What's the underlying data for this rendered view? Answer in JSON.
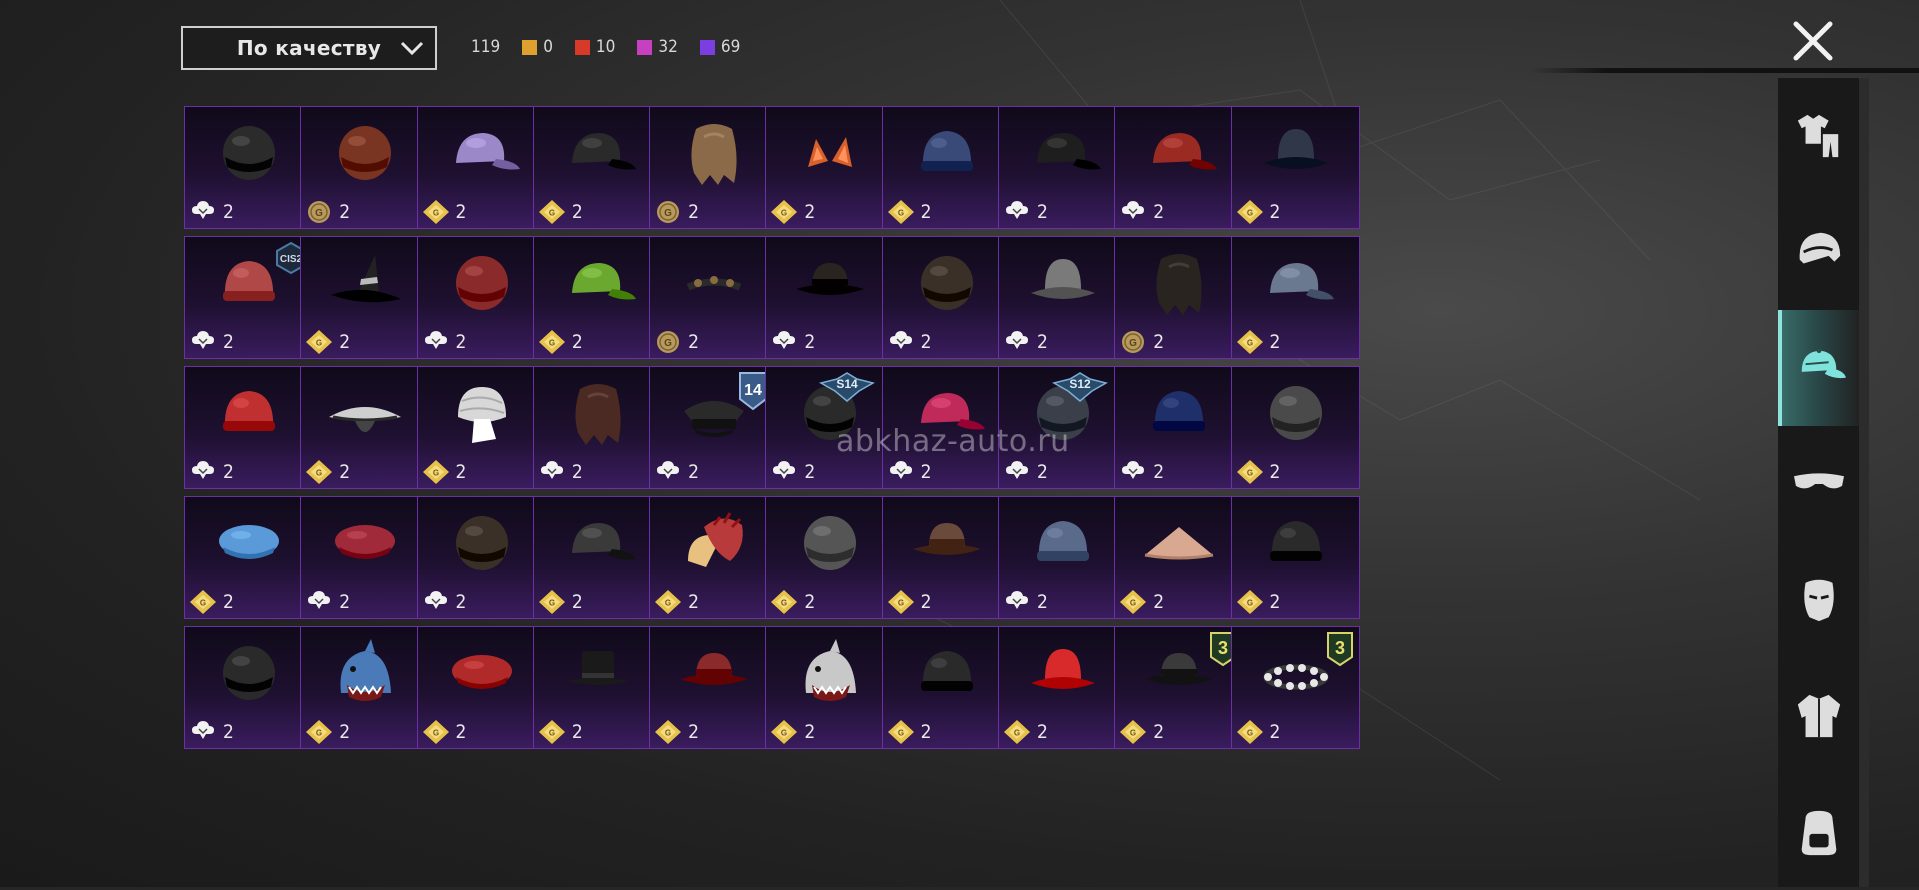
{
  "sort": {
    "label": "По качеству"
  },
  "counts": [
    {
      "value": "119",
      "color": null
    },
    {
      "value": "0",
      "color": "#e0a030"
    },
    {
      "value": "10",
      "color": "#d83a2a"
    },
    {
      "value": "32",
      "color": "#c640c0"
    },
    {
      "value": "69",
      "color": "#7b3ee0"
    }
  ],
  "watermark": "abkhaz-auto.ru",
  "icons": {
    "close": "close-icon",
    "dropdown": "chevron-down-icon"
  },
  "colors": {
    "cell_border": "#6c2fa8",
    "active_tab": "#8fe3dd",
    "cell_bg": "#1e1030"
  },
  "tabs": [
    {
      "name": "outfit-icon",
      "active": false
    },
    {
      "name": "helmet-icon",
      "active": false
    },
    {
      "name": "cap-icon",
      "active": true
    },
    {
      "name": "glasses-icon",
      "active": false
    },
    {
      "name": "mask-icon",
      "active": false
    },
    {
      "name": "jacket-icon",
      "active": false
    },
    {
      "name": "backpack-icon",
      "active": false
    }
  ],
  "items": [
    {
      "name": "black-motorcycle-helmet",
      "icon": "bp",
      "count": "2",
      "color": "#2b2b2b",
      "shape": "helmet"
    },
    {
      "name": "aviator-hat-goggles",
      "icon": "coin",
      "count": "2",
      "color": "#7a3422",
      "shape": "helmet"
    },
    {
      "name": "colorful-cap",
      "icon": "gem",
      "count": "2",
      "color": "#9a88c8",
      "shape": "cap"
    },
    {
      "name": "black-cap",
      "icon": "gem",
      "count": "2",
      "color": "#2a2a2a",
      "shape": "cap"
    },
    {
      "name": "blonde-hair",
      "icon": "coin",
      "count": "2",
      "color": "#8a6a48",
      "shape": "hair"
    },
    {
      "name": "cat-ears",
      "icon": "gem",
      "count": "2",
      "color": "#d8602a",
      "shape": "ears"
    },
    {
      "name": "blue-beanie",
      "icon": "gem",
      "count": "2",
      "color": "#3a4a78",
      "shape": "beanie"
    },
    {
      "name": "black-mesh-cap",
      "icon": "bp",
      "count": "2",
      "color": "#1e1e1e",
      "shape": "cap"
    },
    {
      "name": "red-gold-cap",
      "icon": "bp",
      "count": "2",
      "color": "#9a2a22",
      "shape": "cap"
    },
    {
      "name": "bucket-hat-red-hair",
      "icon": "gem",
      "count": "2",
      "color": "#2f3748",
      "shape": "bucket"
    },
    {
      "name": "striped-bandana",
      "icon": "bp",
      "count": "2",
      "color": "#b04848",
      "shape": "beanie",
      "badge": "CIS2"
    },
    {
      "name": "witch-hat",
      "icon": "gem",
      "count": "2",
      "color": "#222222",
      "shape": "witch"
    },
    {
      "name": "red-racing-helmet",
      "icon": "bp",
      "count": "2",
      "color": "#8a2a2a",
      "shape": "helmet"
    },
    {
      "name": "green-cap",
      "icon": "gem",
      "count": "2",
      "color": "#6aa830",
      "shape": "cap"
    },
    {
      "name": "spiked-headband",
      "icon": "coin",
      "count": "2",
      "color": "#2a2a2a",
      "shape": "band"
    },
    {
      "name": "steampunk-hat",
      "icon": "bp",
      "count": "2",
      "color": "#2a2420",
      "shape": "fedora"
    },
    {
      "name": "samurai-helmet",
      "icon": "bp",
      "count": "2",
      "color": "#3a3028",
      "shape": "helmet"
    },
    {
      "name": "grey-fisherman-hat",
      "icon": "bp",
      "count": "2",
      "color": "#7a7a7a",
      "shape": "bucket"
    },
    {
      "name": "dark-hair",
      "icon": "coin",
      "count": "2",
      "color": "#2a2420",
      "shape": "hair"
    },
    {
      "name": "blue-grey-cap",
      "icon": "gem",
      "count": "2",
      "color": "#6a7890",
      "shape": "cap"
    },
    {
      "name": "red-white-helmet",
      "icon": "bp",
      "count": "2",
      "color": "#c03030",
      "shape": "beanie"
    },
    {
      "name": "straw-rice-hat",
      "icon": "gem",
      "count": "2",
      "color": "#2a2a2a",
      "shape": "rice"
    },
    {
      "name": "white-turban",
      "icon": "gem",
      "count": "2",
      "color": "#d8d8d8",
      "shape": "turban"
    },
    {
      "name": "demon-mask-hair",
      "icon": "bp",
      "count": "2",
      "color": "#4a2a22",
      "shape": "hair"
    },
    {
      "name": "police-cap",
      "icon": "bp",
      "count": "2",
      "color": "#2a2a2a",
      "shape": "police",
      "badge": "14"
    },
    {
      "name": "dark-balaclava",
      "icon": "bp",
      "count": "2",
      "color": "#2a2a2a",
      "shape": "helmet",
      "badge": "S14"
    },
    {
      "name": "pink-black-cap",
      "icon": "bp",
      "count": "2",
      "color": "#c02a5a",
      "shape": "cap"
    },
    {
      "name": "space-helmet",
      "icon": "bp",
      "count": "2",
      "color": "#3a3f4a",
      "shape": "helmet",
      "badge": "S12"
    },
    {
      "name": "navy-beanie",
      "icon": "bp",
      "count": "2",
      "color": "#1e2f6a",
      "shape": "beanie"
    },
    {
      "name": "camo-helmet-goggles",
      "icon": "gem",
      "count": "2",
      "color": "#4a4a4a",
      "shape": "helmet"
    },
    {
      "name": "blue-pom-hat",
      "icon": "gem",
      "count": "2",
      "color": "#5a9ad8",
      "shape": "beret"
    },
    {
      "name": "red-beret",
      "icon": "bp",
      "count": "2",
      "color": "#a02a3a",
      "shape": "beret"
    },
    {
      "name": "leather-pilot-cap",
      "icon": "bp",
      "count": "2",
      "color": "#3a3028",
      "shape": "helmet"
    },
    {
      "name": "dark-grey-cap",
      "icon": "gem",
      "count": "2",
      "color": "#3a3a3a",
      "shape": "cap"
    },
    {
      "name": "fried-chicken-hat",
      "icon": "gem",
      "count": "2",
      "color": "#b83a3a",
      "shape": "chicken"
    },
    {
      "name": "pith-helmet",
      "icon": "gem",
      "count": "2",
      "color": "#555555",
      "shape": "helmet"
    },
    {
      "name": "cowboy-hat",
      "icon": "gem",
      "count": "2",
      "color": "#6a4a3a",
      "shape": "fedora"
    },
    {
      "name": "pom-pom-beanie",
      "icon": "bp",
      "count": "2",
      "color": "#5a6a8a",
      "shape": "beanie"
    },
    {
      "name": "conical-hat",
      "icon": "gem",
      "count": "2",
      "color": "#d8a890",
      "shape": "cone"
    },
    {
      "name": "black-red-beanie",
      "icon": "gem",
      "count": "2",
      "color": "#2a2a2a",
      "shape": "beanie"
    },
    {
      "name": "black-wrestler-mask",
      "icon": "bp",
      "count": "2",
      "color": "#2a2a2a",
      "shape": "helmet"
    },
    {
      "name": "shark-hood",
      "icon": "gem",
      "count": "2",
      "color": "#4a7ab8",
      "shape": "shark"
    },
    {
      "name": "red-beret-2",
      "icon": "gem",
      "count": "2",
      "color": "#b02a2a",
      "shape": "beret"
    },
    {
      "name": "black-top-hat",
      "icon": "gem",
      "count": "2",
      "color": "#1a1a1a",
      "shape": "tophat"
    },
    {
      "name": "red-fedora",
      "icon": "gem",
      "count": "2",
      "color": "#8a2a2a",
      "shape": "fedora"
    },
    {
      "name": "white-shark-head",
      "icon": "gem",
      "count": "2",
      "color": "#c8c8c8",
      "shape": "shark"
    },
    {
      "name": "black-headset-beanie",
      "icon": "gem",
      "count": "2",
      "color": "#2a2a2a",
      "shape": "beanie"
    },
    {
      "name": "red-bucket-hat",
      "icon": "gem",
      "count": "2",
      "color": "#d82a2a",
      "shape": "bucket"
    },
    {
      "name": "grey-fedora",
      "icon": "gem",
      "count": "2",
      "color": "#3a3a3a",
      "shape": "fedora",
      "badge": "3"
    },
    {
      "name": "flower-crown",
      "icon": "gem",
      "count": "2",
      "color": "#e8e8e8",
      "shape": "crown",
      "badge": "3"
    }
  ]
}
